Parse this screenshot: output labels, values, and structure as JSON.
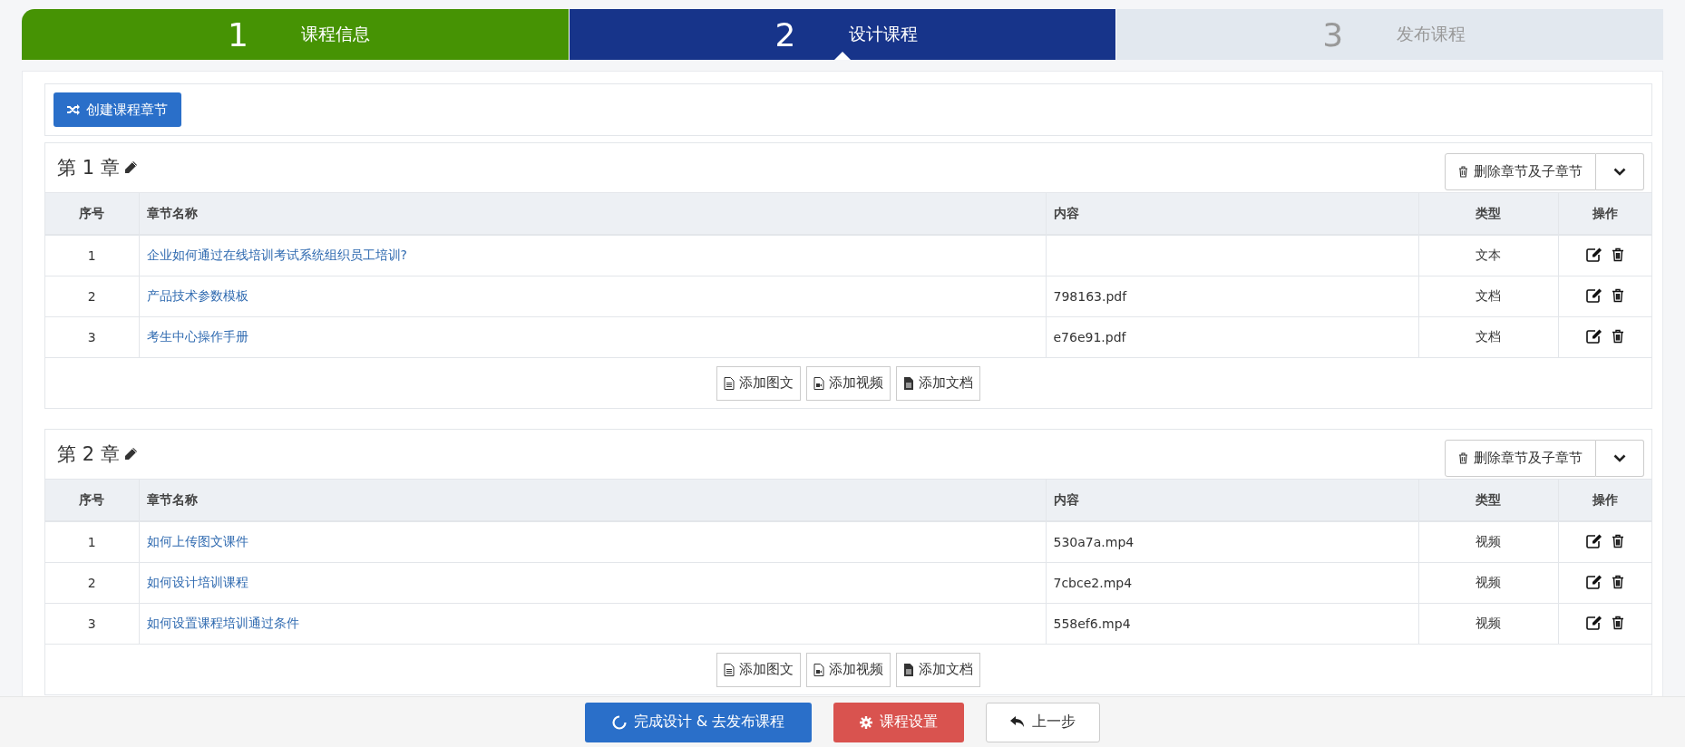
{
  "steps": [
    {
      "number": "1",
      "label": "课程信息",
      "completed": true,
      "selected": false
    },
    {
      "number": "2",
      "label": "设计课程",
      "completed": false,
      "selected": true
    },
    {
      "number": "3",
      "label": "发布课程",
      "completed": false,
      "selected": false
    }
  ],
  "create_button": "创建课程章节",
  "chapters": [
    {
      "title": "第 1 章",
      "delete_button": "删除章节及子章节",
      "columns": [
        "序号",
        "章节名称",
        "内容",
        "类型",
        "操作"
      ],
      "rows": [
        {
          "index": "1",
          "name": "企业如何通过在线培训考试系统组织员工培训?",
          "content": "",
          "type": "文本"
        },
        {
          "index": "2",
          "name": "产品技术参数模板",
          "content": "798163.pdf",
          "type": "文档"
        },
        {
          "index": "3",
          "name": "考生中心操作手册",
          "content": "e76e91.pdf",
          "type": "文档"
        }
      ],
      "add_buttons": [
        {
          "kind": "text",
          "label": "添加图文"
        },
        {
          "kind": "video",
          "label": "添加视频"
        },
        {
          "kind": "document",
          "label": "添加文档"
        }
      ]
    },
    {
      "title": "第 2 章",
      "delete_button": "删除章节及子章节",
      "columns": [
        "序号",
        "章节名称",
        "内容",
        "类型",
        "操作"
      ],
      "rows": [
        {
          "index": "1",
          "name": "如何上传图文课件",
          "content": "530a7a.mp4",
          "type": "视频"
        },
        {
          "index": "2",
          "name": "如何设计培训课程",
          "content": "7cbce2.mp4",
          "type": "视频"
        },
        {
          "index": "3",
          "name": "如何设置课程培训通过条件",
          "content": "558ef6.mp4",
          "type": "视频"
        }
      ],
      "add_buttons": [
        {
          "kind": "text",
          "label": "添加图文"
        },
        {
          "kind": "video",
          "label": "添加视频"
        },
        {
          "kind": "document",
          "label": "添加文档"
        }
      ]
    }
  ],
  "footer_buttons": [
    {
      "kind": "primary",
      "label": "完成设计 & 去发布课程"
    },
    {
      "kind": "danger",
      "label": "课程设置"
    },
    {
      "kind": "default",
      "label": "上一步"
    }
  ]
}
